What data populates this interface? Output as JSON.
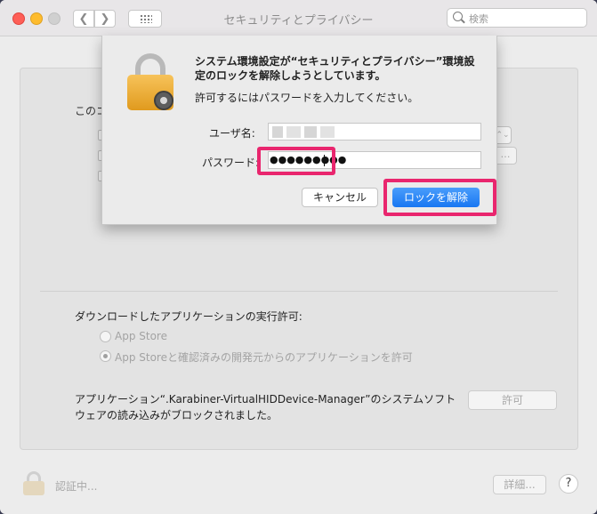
{
  "window": {
    "title": "セキュリティとプライバシー"
  },
  "search": {
    "placeholder": "検索"
  },
  "panel": {
    "partial_label": "このコ",
    "download_label": "ダウンロードしたアプリケーションの実行許可:",
    "radio_options": [
      {
        "label": "App Store",
        "checked": false
      },
      {
        "label": "App Storeと確認済みの開発元からのアプリケーションを許可",
        "checked": true
      }
    ],
    "blocked_message": "アプリケーション“.Karabiner-VirtualHIDDevice-Manager”のシステムソフトウェアの読み込みがブロックされました。",
    "allow_label": "許可"
  },
  "footer": {
    "auth_text": "認証中...",
    "detail_label": "詳細...",
    "help_label": "?"
  },
  "dialog": {
    "title": "システム環境設定が“セキュリティとプライバシー”環境設定のロックを解除しようとしています。",
    "subtitle": "許可するにはパスワードを入力してください。",
    "user_label": "ユーザ名:",
    "password_label": "パスワード:",
    "password_mask": "●●●●●●●●●",
    "cancel_label": "キャンセル",
    "unlock_label": "ロックを解除"
  },
  "colors": {
    "highlight": "#e9266e",
    "primary_button": "#1877f2"
  },
  "icons": [
    "back-chevron-icon",
    "forward-chevron-icon",
    "grid-icon",
    "search-icon",
    "lock-icon",
    "gear-icon"
  ]
}
